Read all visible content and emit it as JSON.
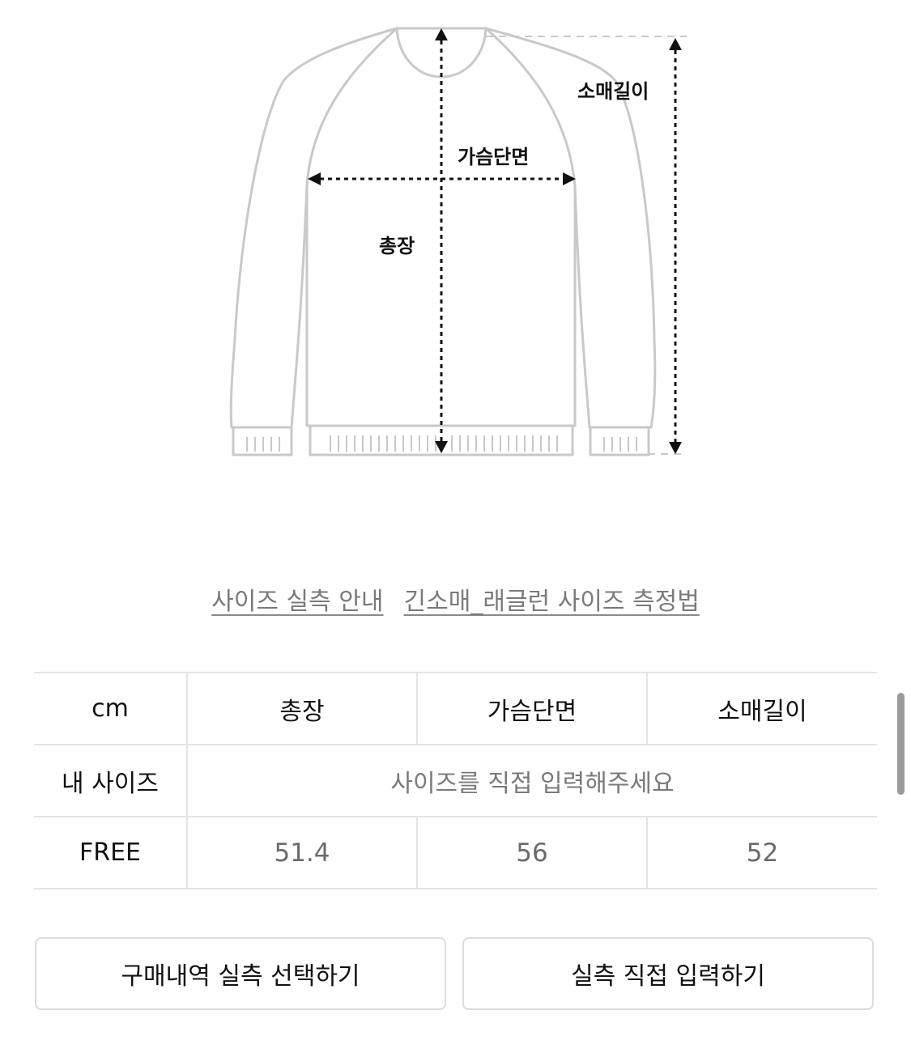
{
  "diagram": {
    "labels": {
      "sleeve_length": "소매길이",
      "chest_width": "가슴단면",
      "total_length": "총장"
    }
  },
  "links": {
    "size_guide": "사이즈 실측 안내",
    "measure_method": "긴소매_래글런 사이즈 측정법"
  },
  "table": {
    "unit": "cm",
    "columns": [
      "총장",
      "가슴단면",
      "소매길이"
    ],
    "my_size": {
      "label": "내 사이즈",
      "placeholder": "사이즈를 직접 입력해주세요"
    },
    "rows": [
      {
        "size": "FREE",
        "values": [
          "51.4",
          "56",
          "52"
        ]
      }
    ]
  },
  "buttons": {
    "select_from_orders": "구매내역 실측 선택하기",
    "direct_input": "실측 직접 입력하기"
  }
}
